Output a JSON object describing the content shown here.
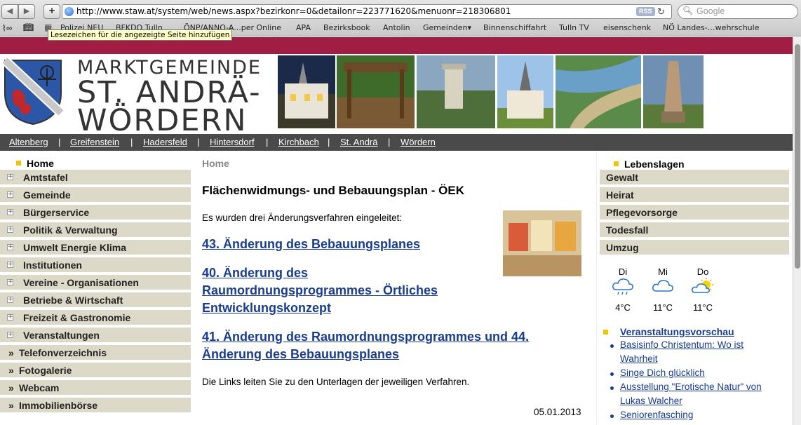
{
  "browser": {
    "url": "http://www.staw.at/system/web/news.aspx?bezirkonr=0&detailonr=223771620&menuonr=218306801",
    "rss_label": "RSS",
    "search_placeholder": "Google",
    "tooltip": "Lesezeichen für die angezeigte Seite hinzufügen",
    "bookmarks": [
      "Polizei NEU",
      "BFKDO Tulln",
      "ÖNP/ANNO-A...per Online",
      "APA",
      "Bezirksbook",
      "Antolin",
      "Gemeinden▾",
      "Binnenschiffahrt",
      "Tulln TV",
      "eisenschenk",
      "NÖ Landes-…wehrschule"
    ]
  },
  "site": {
    "line1": "MARKTGEMEINDE",
    "line2": "ST. ANDRÄ-",
    "line3": "WÖRDERN"
  },
  "places": [
    "Altenberg",
    "Greifenstein",
    "Hadersfeld",
    "Hintersdorf",
    "Kirchbach",
    "St. Andrä",
    "Wördern"
  ],
  "leftnav": {
    "home": "Home",
    "items": [
      "Amtstafel",
      "Gemeinde",
      "Bürgerservice",
      "Politik & Verwaltung",
      "Umwelt Energie Klima",
      "Institutionen",
      "Vereine - Organisationen",
      "Betriebe & Wirtschaft",
      "Freizeit & Gastronomie",
      "Veranstaltungen"
    ],
    "links": [
      "Telefonverzeichnis",
      "Fotogalerie",
      "Webcam",
      "Immobilienbörse"
    ]
  },
  "main": {
    "breadcrumb": "Home",
    "title": "Flächenwidmungs- und Bebauungsplan - ÖEK",
    "intro": "Es wurden drei Änderungsverfahren eingeleitet:",
    "links": [
      [
        "43. Änderung des Bebauungsplanes"
      ],
      [
        "40. Änderung des",
        "Raumordnungsprogrammes - Örtliches",
        "Entwicklungskonzept"
      ],
      [
        "41. Änderung des Raumordnungsprogrammes und 44.",
        "Änderung des Bebauungsplanes"
      ]
    ],
    "outro": "Die Links leiten Sie zu den Unterlagen der jeweiligen Verfahren.",
    "date": "05.01.2013"
  },
  "right": {
    "title": "Lebenslagen",
    "items": [
      "Gewalt",
      "Heirat",
      "Pflegevorsorge",
      "Todesfall",
      "Umzug"
    ],
    "weather": [
      {
        "day": "Di",
        "temp": "4°C",
        "icon": "rain-cloud-icon"
      },
      {
        "day": "Mi",
        "temp": "11°C",
        "icon": "cloud-icon"
      },
      {
        "day": "Do",
        "temp": "11°C",
        "icon": "sun-cloud-icon"
      }
    ],
    "events_title": "Veranstaltungsvorschau",
    "events": [
      [
        "Basisinfo Christentum: Wo ist",
        "Wahrheit"
      ],
      [
        "Singe Dich glücklich"
      ],
      [
        "Ausstellung \"Erotische Natur\" von",
        "Lukas Walcher"
      ],
      [
        "Seniorenfasching"
      ]
    ]
  },
  "colors": {
    "brand": "#a01e44",
    "nav_bg": "#ddd9c9",
    "link": "#1a3d8f",
    "bullet": "#f2c300"
  }
}
